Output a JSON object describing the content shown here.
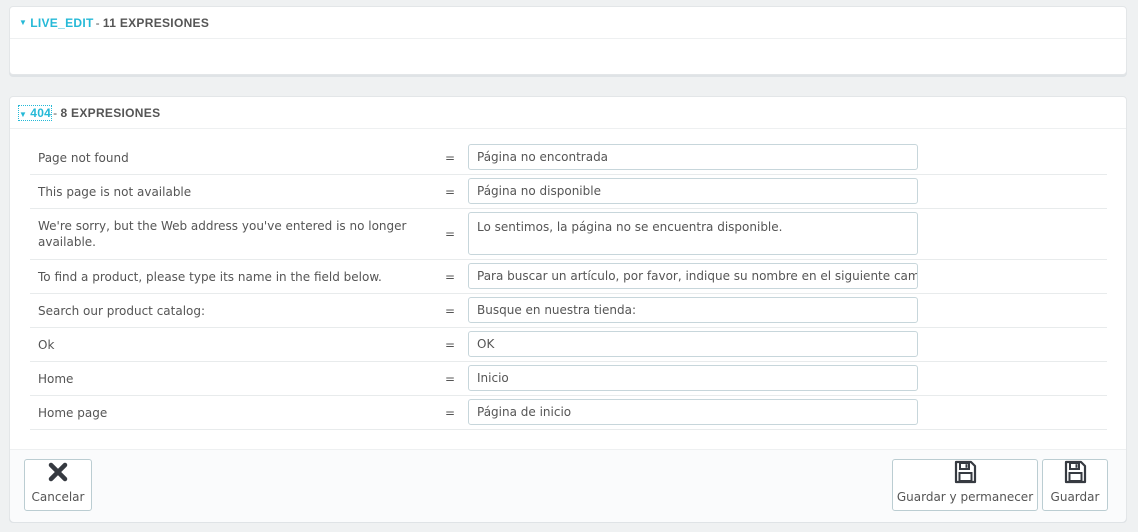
{
  "panel1": {
    "group": "LIVE_EDIT",
    "count": "11 EXPRESIONES"
  },
  "panel2": {
    "group": "404",
    "count": "8 EXPRESIONES",
    "rows": [
      {
        "label": "Page not found",
        "eq": "=",
        "value": "Página no encontrada"
      },
      {
        "label": "This page is not available",
        "eq": "=",
        "value": "Página no disponible"
      },
      {
        "label": "We're sorry, but the Web address you've entered is no longer available.",
        "eq": "=",
        "value": "Lo sentimos, la página no se encuentra disponible."
      },
      {
        "label": "To find a product, please type its name in the field below.",
        "eq": "=",
        "value": "Para buscar un artículo, por favor, indique su nombre en el siguiente campo:"
      },
      {
        "label": "Search our product catalog:",
        "eq": "=",
        "value": "Busque en nuestra tienda:"
      },
      {
        "label": "Ok",
        "eq": "=",
        "value": "OK"
      },
      {
        "label": "Home",
        "eq": "=",
        "value": "Inicio"
      },
      {
        "label": "Home page",
        "eq": "=",
        "value": "Página de inicio"
      }
    ]
  },
  "footer": {
    "cancel_label": "Cancelar",
    "save_stay_label": "Guardar y permanecer",
    "save_label": "Guardar"
  },
  "icons": {
    "expand": "caret-down-icon",
    "cancel": "close-icon",
    "save": "floppy-disk-icon"
  },
  "colors": {
    "accent": "#25b9d7",
    "background": "#eff1f2",
    "text": "#555555"
  }
}
